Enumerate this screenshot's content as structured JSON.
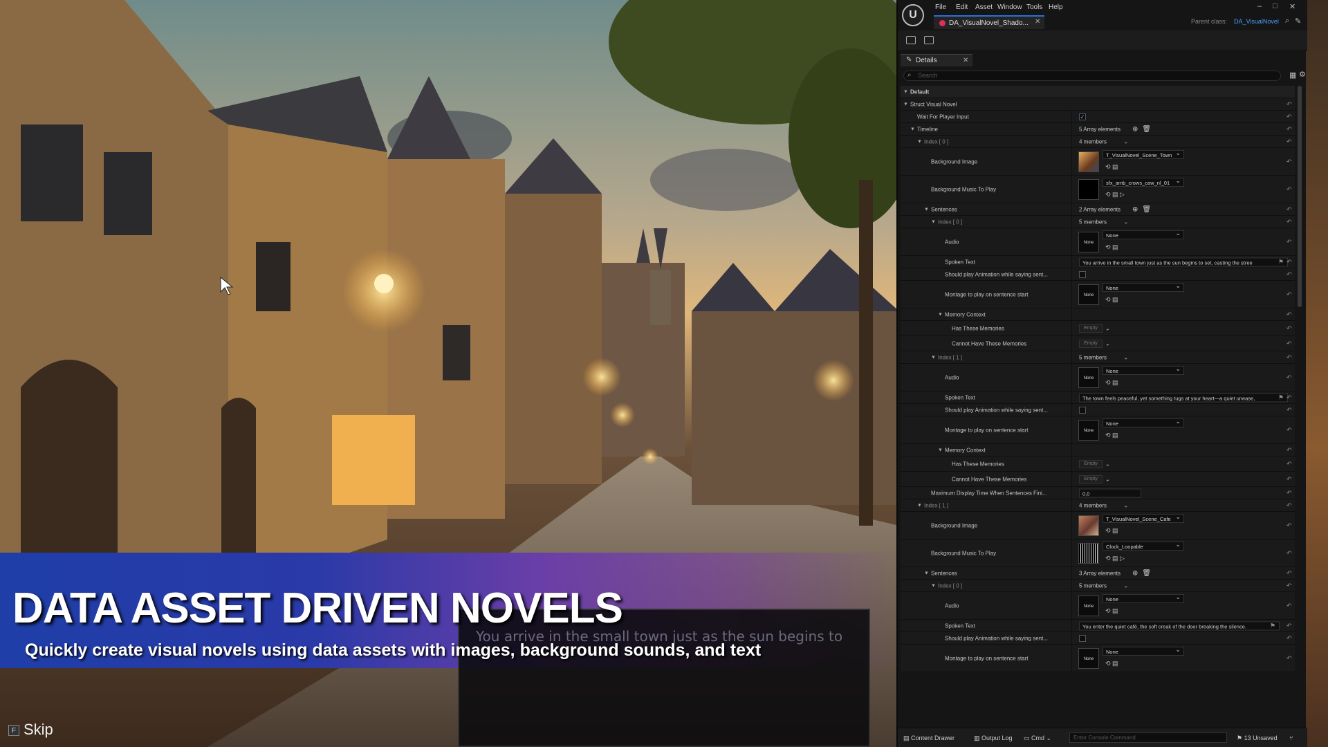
{
  "scene": {
    "banner_title": "DATA ASSET DRIVEN NOVELS",
    "banner_subtitle": "Quickly create visual novels using data assets with images, background sounds, and text",
    "dialogue_text": "You arrive in the small town just as the sun begins to",
    "skip_key": "F",
    "skip_label": "Skip"
  },
  "editor": {
    "menu": [
      "File",
      "Edit",
      "Asset",
      "Window",
      "Tools",
      "Help"
    ],
    "doc_tab": "DA_VisualNovel_Shado...",
    "parent_class_label": "Parent class:",
    "parent_class_value": "DA_VisualNovel",
    "details_tab": "Details",
    "search_placeholder": "Search",
    "rows": {
      "default": "Default",
      "struct": "Struct Visual Novel",
      "wait": "Wait For Player Input",
      "timeline": "Timeline",
      "timeline_val": "5 Array elements",
      "idx0": "Index [ 0 ]",
      "members4": "4 members",
      "members5": "5 members",
      "bg_image": "Background Image",
      "bg_image_val0": "T_VisualNovel_Scene_Town",
      "bg_music": "Background Music To Play",
      "bg_music_val0": "sfx_amb_crows_caw_nl_01",
      "sentences": "Sentences",
      "sentences_val0": "2 Array elements",
      "sent_idx0": "Index [ 0 ]",
      "audio": "Audio",
      "none": "None",
      "spoken": "Spoken Text",
      "spoken_val0": "You arrive in the small town just as the sun begins to set, casting the stree",
      "should_play": "Should play Animation while saying sent...",
      "montage": "Montage to play on sentence start",
      "memory": "Memory Context",
      "has_mem": "Has These Memories",
      "cannot_mem": "Cannot Have These Memories",
      "empty": "Empty",
      "sent_idx1": "Index [ 1 ]",
      "spoken_val1": "The town feels peaceful, yet something tugs at your heart—a quiet unease,",
      "max_display": "Maximum Display Time When Sentences Fini...",
      "max_display_val": "0,0",
      "idx1": "Index [ 1 ]",
      "bg_image_val1": "T_VisualNovel_Scene_Cafe",
      "bg_music_val1": "Clock_Loopable",
      "sentences_val1": "3 Array elements",
      "spoken_val2": "You enter the quiet café, the soft creak of the door breaking the silence."
    },
    "status": {
      "content_drawer": "Content Drawer",
      "output_log": "Output Log",
      "cmd": "Cmd",
      "console_placeholder": "Enter Console Command",
      "unsaved": "13 Unsaved"
    }
  }
}
